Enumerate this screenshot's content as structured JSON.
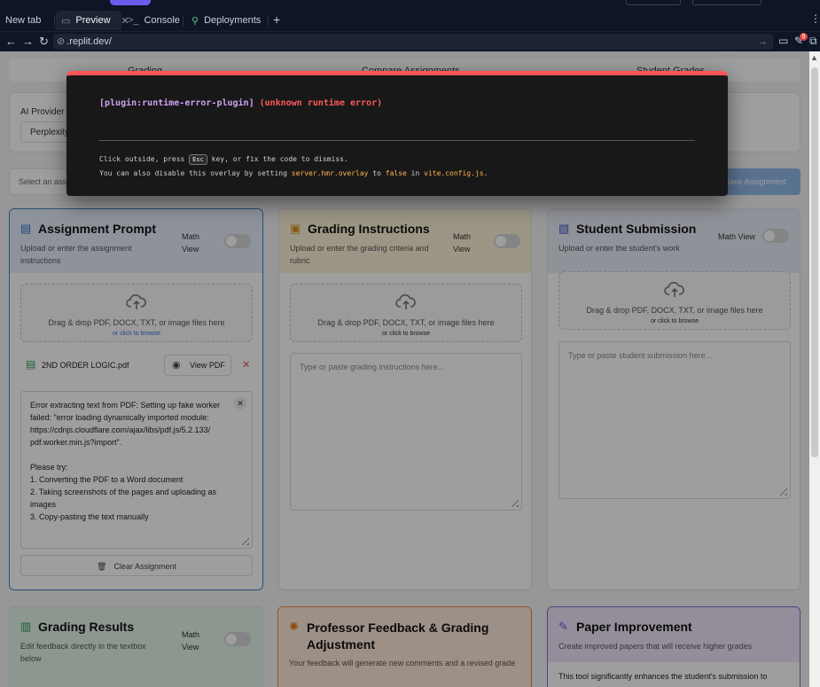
{
  "browser": {
    "tabs": [
      {
        "label": "New tab"
      },
      {
        "label": "Preview"
      },
      {
        "label": "Console"
      },
      {
        "label": "Deployments"
      }
    ],
    "url": ".replit.dev/",
    "notification_count": "9"
  },
  "page": {
    "top_tabs": [
      "Grading",
      "Compare Assignments",
      "Student Grades"
    ],
    "provider_label": "AI Provider",
    "provider_value": "Perplexity",
    "assignment_placeholder": "Select an assignment",
    "save_assignment": "Save Assignment",
    "math_view": "Math View",
    "cards": {
      "prompt": {
        "title": "Assignment Prompt",
        "subtitle": "Upload or enter the assignment instructions",
        "drop_text": "Drag & drop PDF, DOCX, TXT, or image files here",
        "drop_click": "or click to browse",
        "file_name": "2ND ORDER LOGIC.pdf",
        "view_pdf": "View PDF",
        "error_lines": [
          "Error extracting text from PDF: Setting up fake worker",
          "failed: \"error loading dynamically imported module:",
          "https://cdnjs.cloudflare.com/ajax/libs/pdf.js/5.2.133/",
          "pdf.worker.min.js?import\".",
          "",
          "Please try:",
          "1. Converting the PDF to a Word document",
          "2. Taking screenshots of the pages and uploading as",
          "images",
          "3. Copy-pasting the text manually"
        ],
        "clear": "Clear Assignment"
      },
      "grading": {
        "title": "Grading Instructions",
        "subtitle": "Upload or enter the grading criteria and rubric",
        "drop_text": "Drag & drop PDF, DOCX, TXT, or image files here",
        "drop_click": "or click to browse",
        "placeholder": "Type or paste grading instructions here..."
      },
      "student": {
        "title": "Student Submission",
        "subtitle": "Upload or enter the student's work",
        "drop_text": "Drag & drop PDF, DOCX, TXT, or image files here",
        "drop_click": "or click to browse",
        "placeholder": "Type or paste student submission here..."
      },
      "results": {
        "title": "Grading Results",
        "subtitle": "Edit feedback directly in the textbox below"
      },
      "feedback": {
        "title_line1": "Professor Feedback & Grading",
        "title_line2": "Adjustment",
        "subtitle": "Your feedback will generate new comments and a revised grade"
      },
      "paper": {
        "title": "Paper Improvement",
        "subtitle": "Create improved papers that will receive higher grades",
        "body": "This tool significantly enhances the student's submission to"
      }
    }
  },
  "error_overlay": {
    "plugin": "[plugin:runtime-error-plugin]",
    "message": "(unknown runtime error)",
    "tip1_a": "Click outside, press",
    "tip1_key": "Esc",
    "tip1_b": "key, or fix the code to dismiss.",
    "tip2_a": "You can also disable this overlay by setting",
    "tip2_code1": "server.hmr.overlay",
    "tip2_b": "to",
    "tip2_code2": "false",
    "tip2_c": "in",
    "tip2_code3": "vite.config.js",
    "tip2_d": "."
  },
  "colors": {
    "prompt_head": "#e6eefb",
    "grading_head": "#fcf3d8",
    "student_head": "#e9ecf7",
    "results_head": "#e3f4e8",
    "feedback_head": "#fde9d8",
    "paper_head": "#efe6fb",
    "error_red": "#ff5555"
  }
}
